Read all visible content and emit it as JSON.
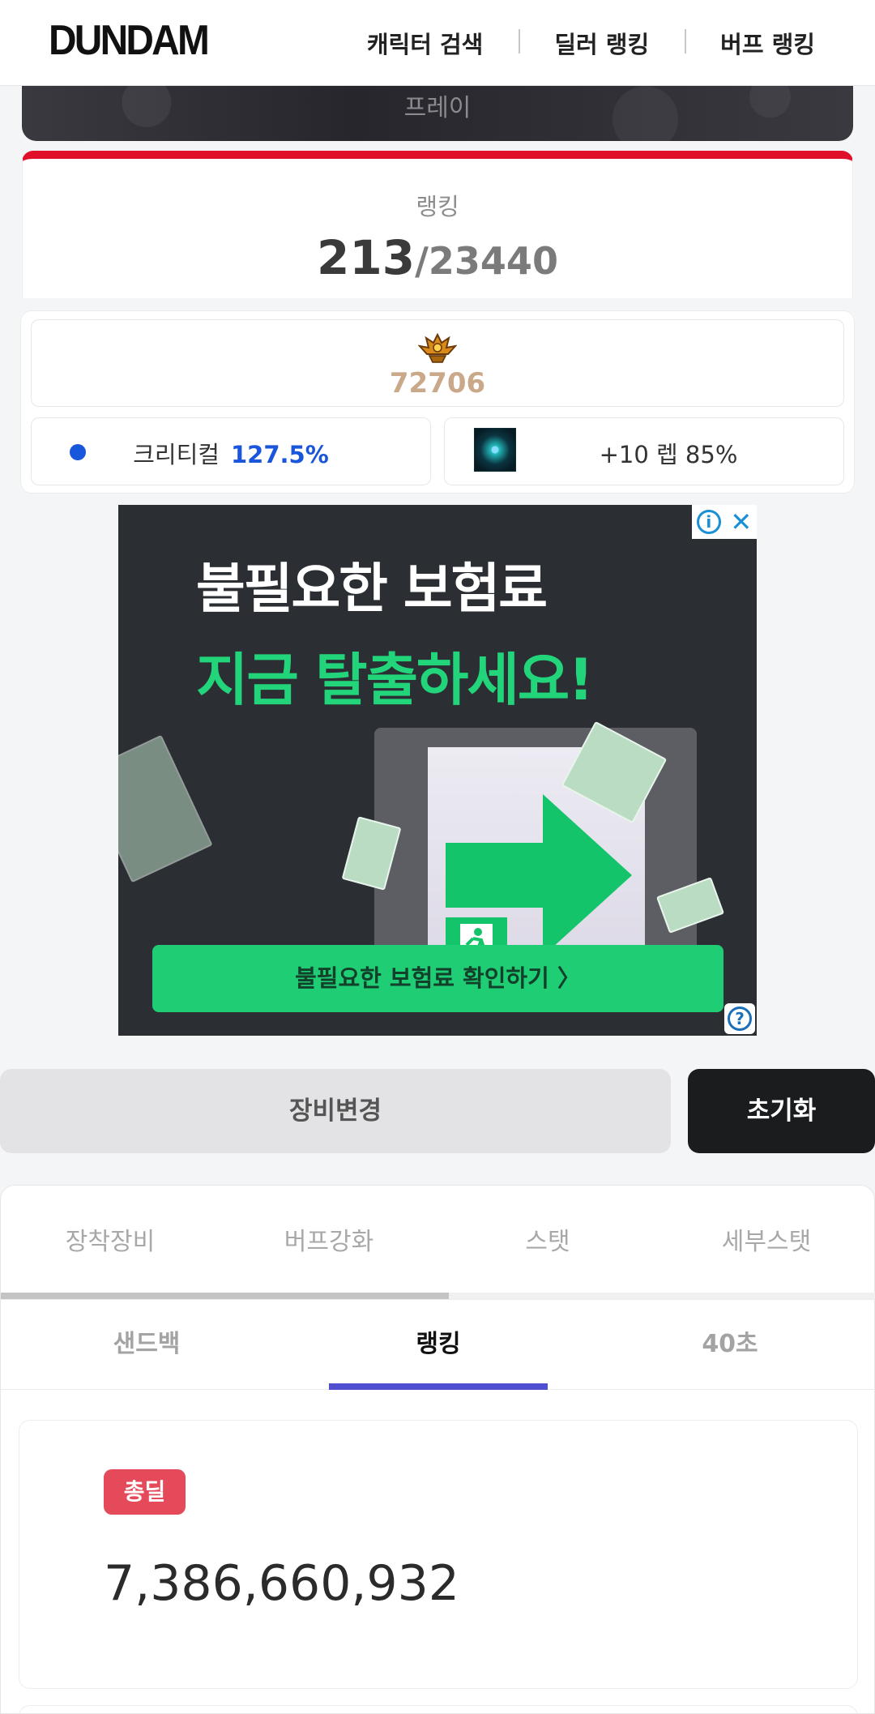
{
  "header": {
    "logo": "DUNDAM",
    "nav": [
      "캐릭터 검색",
      "딜러 랭킹",
      "버프 랭킹"
    ]
  },
  "banner": {
    "text": "프레이"
  },
  "rank": {
    "label": "랭킹",
    "position": "213",
    "total": "/23440"
  },
  "stats": {
    "fame_value": "72706",
    "crit_label": "크리티컬",
    "crit_value": "127.5%",
    "skill_text": "+10 렙 85%"
  },
  "ad": {
    "line1": "불필요한 보험료",
    "line2": "지금 탈출하세요!",
    "cta": "불필요한 보험료 확인하기 〉",
    "info_icon": "info-icon",
    "close_icon": "close-icon",
    "help_icon": "help-icon"
  },
  "actions": {
    "change_label": "장비변경",
    "reset_label": "초기화"
  },
  "tabs_primary": [
    "장착장비",
    "버프강화",
    "스탯",
    "세부스탯"
  ],
  "tabs_secondary": [
    "샌드백",
    "랭킹",
    "40초"
  ],
  "damage": {
    "badge": "총딜",
    "value": "7,386,660,932"
  },
  "colors": {
    "accent_red": "#e0102a",
    "crit_blue": "#1a56db",
    "fame_gold": "#c9a98a",
    "tab_indicator": "#4f4fd0",
    "badge_red": "#e44a5a",
    "ad_green": "#1fce74"
  }
}
